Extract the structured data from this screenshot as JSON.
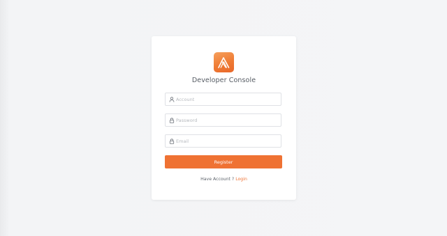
{
  "app": {
    "title": "Developer Console",
    "accent_color": "#ef7233"
  },
  "form": {
    "account": {
      "placeholder": "Account",
      "value": "",
      "icon": "user-icon"
    },
    "password": {
      "placeholder": "Password",
      "value": "",
      "icon": "lock-icon"
    },
    "email": {
      "placeholder": "Email",
      "value": "",
      "icon": "lock-icon"
    },
    "register_label": "Register"
  },
  "footer": {
    "prompt": "Have Account ?",
    "login_label": "Login"
  }
}
